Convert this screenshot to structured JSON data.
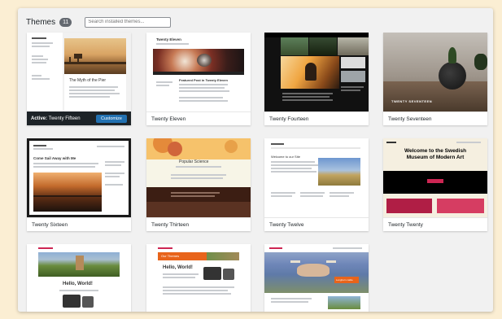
{
  "header": {
    "title": "Themes",
    "count": "11",
    "search_placeholder": "Search installed themes..."
  },
  "active_theme": {
    "label_prefix": "Active:",
    "name": "Twenty Fifteen",
    "customize_label": "Customize",
    "preview_heading": "The Myth of the Pier"
  },
  "themes": [
    {
      "name": "Twenty Eleven",
      "preview_title": "Twenty Eleven",
      "preview_heading": "Featured Post in Twenty Eleven"
    },
    {
      "name": "Twenty Fourteen"
    },
    {
      "name": "Twenty Seventeen",
      "preview_caption": "TWENTY SEVENTEEN"
    },
    {
      "name": "Twenty Sixteen",
      "preview_heading": "Come Sail Away with Me"
    },
    {
      "name": "Twenty Thirteen",
      "preview_title": "Popular Science"
    },
    {
      "name": "Twenty Twelve",
      "preview_heading": "Welcome to our Site"
    },
    {
      "name": "Twenty Twenty",
      "preview_heading": "Welcome to the Swedish Museum of Modern Art"
    },
    {
      "name": "",
      "preview_title": "Hello, World!"
    },
    {
      "name": "",
      "preview_title": "Hello, World!",
      "preview_badge": "Our Themes"
    },
    {
      "name": "",
      "preview_caption": "Longhorn cattle"
    }
  ],
  "colors": {
    "page_bg": "#fbeed3",
    "panel_bg": "#f1f1f1",
    "active_bar": "#1d2327",
    "customize_button": "#2271b1"
  }
}
